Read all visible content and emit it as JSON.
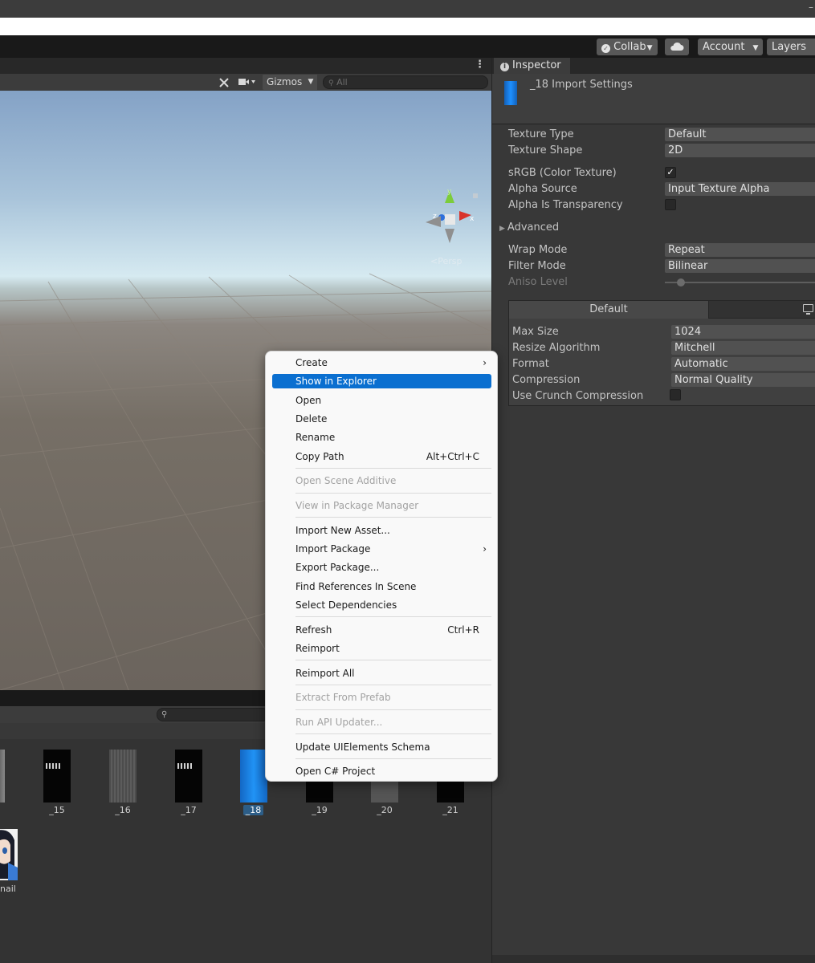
{
  "titlebar": {
    "minimize_label": "–"
  },
  "toolbar": {
    "collab_label": "Collab",
    "account_label": "Account",
    "layers_label": "Layers"
  },
  "scene": {
    "gizmos_label": "Gizmos",
    "search_placeholder": "All",
    "persp_label": "<Persp"
  },
  "project": {
    "thumbnails": [
      "_15",
      "_16",
      "_17",
      "_18",
      "_19",
      "_20",
      "_21"
    ],
    "selected_thumbnail": "_18",
    "avatar_label": "nail"
  },
  "inspector": {
    "tab_label": "Inspector",
    "title": "_18 Import Settings",
    "props": {
      "texture_type_label": "Texture Type",
      "texture_type_value": "Default",
      "texture_shape_label": "Texture Shape",
      "texture_shape_value": "2D",
      "srgb_label": "sRGB (Color Texture)",
      "srgb_checked": "✓",
      "alpha_source_label": "Alpha Source",
      "alpha_source_value": "Input Texture Alpha",
      "alpha_transparency_label": "Alpha Is Transparency",
      "advanced_label": "Advanced",
      "wrap_mode_label": "Wrap Mode",
      "wrap_mode_value": "Repeat",
      "filter_mode_label": "Filter Mode",
      "filter_mode_value": "Bilinear",
      "aniso_level_label": "Aniso Level"
    },
    "platform": {
      "tab_label": "Default",
      "max_size_label": "Max Size",
      "max_size_value": "1024",
      "resize_algorithm_label": "Resize Algorithm",
      "resize_algorithm_value": "Mitchell",
      "format_label": "Format",
      "format_value": "Automatic",
      "compression_label": "Compression",
      "compression_value": "Normal Quality",
      "crunch_label": "Use Crunch Compression"
    }
  },
  "context_menu": {
    "items": [
      {
        "label": "Create",
        "shortcut": "",
        "submenu": true,
        "disabled": false,
        "selected": false
      },
      {
        "label": "Show in Explorer",
        "shortcut": "",
        "submenu": false,
        "disabled": false,
        "selected": true
      },
      {
        "label": "Open",
        "shortcut": "",
        "submenu": false,
        "disabled": false,
        "selected": false
      },
      {
        "label": "Delete",
        "shortcut": "",
        "submenu": false,
        "disabled": false,
        "selected": false
      },
      {
        "label": "Rename",
        "shortcut": "",
        "submenu": false,
        "disabled": false,
        "selected": false
      },
      {
        "label": "Copy Path",
        "shortcut": "Alt+Ctrl+C",
        "submenu": false,
        "disabled": false,
        "selected": false
      },
      {
        "label": "Open Scene Additive",
        "shortcut": "",
        "submenu": false,
        "disabled": true,
        "selected": false
      },
      {
        "label": "View in Package Manager",
        "shortcut": "",
        "submenu": false,
        "disabled": true,
        "selected": false
      },
      {
        "label": "Import New Asset...",
        "shortcut": "",
        "submenu": false,
        "disabled": false,
        "selected": false
      },
      {
        "label": "Import Package",
        "shortcut": "",
        "submenu": true,
        "disabled": false,
        "selected": false
      },
      {
        "label": "Export Package...",
        "shortcut": "",
        "submenu": false,
        "disabled": false,
        "selected": false
      },
      {
        "label": "Find References In Scene",
        "shortcut": "",
        "submenu": false,
        "disabled": false,
        "selected": false
      },
      {
        "label": "Select Dependencies",
        "shortcut": "",
        "submenu": false,
        "disabled": false,
        "selected": false
      },
      {
        "label": "Refresh",
        "shortcut": "Ctrl+R",
        "submenu": false,
        "disabled": false,
        "selected": false
      },
      {
        "label": "Reimport",
        "shortcut": "",
        "submenu": false,
        "disabled": false,
        "selected": false
      },
      {
        "label": "Reimport All",
        "shortcut": "",
        "submenu": false,
        "disabled": false,
        "selected": false
      },
      {
        "label": "Extract From Prefab",
        "shortcut": "",
        "submenu": false,
        "disabled": true,
        "selected": false
      },
      {
        "label": "Run API Updater...",
        "shortcut": "",
        "submenu": false,
        "disabled": true,
        "selected": false
      },
      {
        "label": "Update UIElements Schema",
        "shortcut": "",
        "submenu": false,
        "disabled": false,
        "selected": false
      },
      {
        "label": "Open C# Project",
        "shortcut": "",
        "submenu": false,
        "disabled": false,
        "selected": false
      }
    ]
  },
  "colors": {
    "selection_blue": "#0a6fd0",
    "texture_blue": "#1e90ff",
    "panel_bg": "#383838"
  }
}
